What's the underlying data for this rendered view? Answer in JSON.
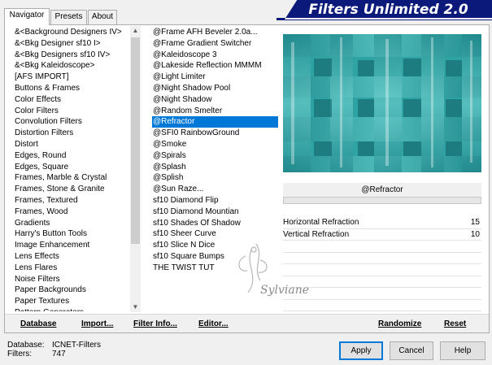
{
  "tabs": [
    {
      "label": "Navigator",
      "active": true
    },
    {
      "label": "Presets",
      "active": false
    },
    {
      "label": "About",
      "active": false
    }
  ],
  "logo": "Filters Unlimited 2.0",
  "categories": [
    "&<Background Designers IV>",
    "&<Bkg Designer sf10 I>",
    "&<Bkg Designers sf10 IV>",
    "&<Bkg Kaleidoscope>",
    "[AFS IMPORT]",
    "Buttons & Frames",
    "Color Effects",
    "Color Filters",
    "Convolution Filters",
    "Distortion Filters",
    "Distort",
    "Edges, Round",
    "Edges, Square",
    "Frames, Marble & Crystal",
    "Frames, Stone & Granite",
    "Frames, Textured",
    "Frames, Wood",
    "Gradients",
    "Harry's Button Tools",
    "Image Enhancement",
    "Lens Effects",
    "Lens Flares",
    "Noise Filters",
    "Paper Backgrounds",
    "Paper Textures",
    "Pattern Generators"
  ],
  "filters": [
    "@Frame AFH Beveler 2.0a...",
    "@Frame Gradient Switcher",
    "@Kaleidoscope 3",
    "@Lakeside Reflection MMMM",
    "@Light Limiter",
    "@Night Shadow Pool",
    "@Night Shadow",
    "@Random Smelter",
    "@Refractor",
    "@SFI0 RainbowGround",
    "@Smoke",
    "@Spirals",
    "@Splash",
    "@Splish",
    "@Sun Raze...",
    "sf10 Diamond Flip",
    "sf10 Diamond Mountian",
    "sf10 Shades Of Shadow",
    "sf10 Sheer Curve",
    "sf10 Slice N Dice",
    "sf10 Square Bumps",
    "THE TWIST TUT"
  ],
  "selected_filter_index": 8,
  "selected_filter_name": "@Refractor",
  "params": [
    {
      "label": "Horizontal Refraction",
      "value": "15"
    },
    {
      "label": "Vertical Refraction",
      "value": "10"
    }
  ],
  "toolbar": {
    "database": "Database",
    "import": "Import...",
    "filter_info": "Filter Info...",
    "editor": "Editor...",
    "randomize": "Randomize",
    "reset": "Reset"
  },
  "footer": {
    "database_label": "Database:",
    "database_value": "ICNET-Filters",
    "filters_label": "Filters:",
    "filters_value": "747"
  },
  "buttons": {
    "apply": "Apply",
    "cancel": "Cancel",
    "help": "Help"
  },
  "watermark": "Sylviane",
  "colors": {
    "logo_bg": "#0b1a7a",
    "selection": "#0078d7",
    "preview": "#2c9a9a"
  }
}
